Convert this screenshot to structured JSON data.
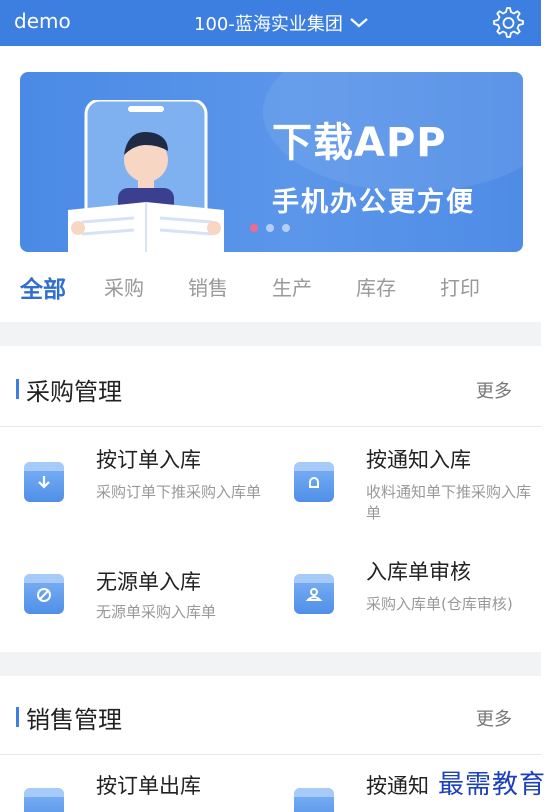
{
  "topbar": {
    "user": "demo",
    "org": "100-蓝海实业集团",
    "icons": [
      "chevron-down-icon",
      "gear-icon"
    ]
  },
  "banner": {
    "title": "下载APP",
    "subtitle": "手机办公更方便",
    "slide_count": 3,
    "active_slide": 1
  },
  "tabs": [
    {
      "label": "全部",
      "active": true
    },
    {
      "label": "采购",
      "active": false
    },
    {
      "label": "销售",
      "active": false
    },
    {
      "label": "生产",
      "active": false
    },
    {
      "label": "库存",
      "active": false
    },
    {
      "label": "打印",
      "active": false
    }
  ],
  "purchase": {
    "title": "采购管理",
    "more": "更多",
    "items": [
      {
        "title": "按订单入库",
        "desc": "采购订单下推采购入库单",
        "icon": "download-icon"
      },
      {
        "title": "按通知入库",
        "desc": "收料通知单下推采购入库单",
        "icon": "bell-icon"
      },
      {
        "title": "无源单入库",
        "desc": "无源单采购入库单",
        "icon": "no-entry-icon"
      },
      {
        "title": "入库单审核",
        "desc": "采购入库单(仓库审核)",
        "icon": "user-check-icon"
      }
    ]
  },
  "sales": {
    "title": "销售管理",
    "more": "更多",
    "items": [
      {
        "title": "按订单出库",
        "icon": "upload-icon"
      },
      {
        "title": "按通知",
        "icon": "bell-icon"
      }
    ]
  },
  "watermark": "最需教育",
  "colors": {
    "primary": "#3d7fe0",
    "active_tab": "#2f6fd0",
    "dot_active": "#f06a8e"
  }
}
